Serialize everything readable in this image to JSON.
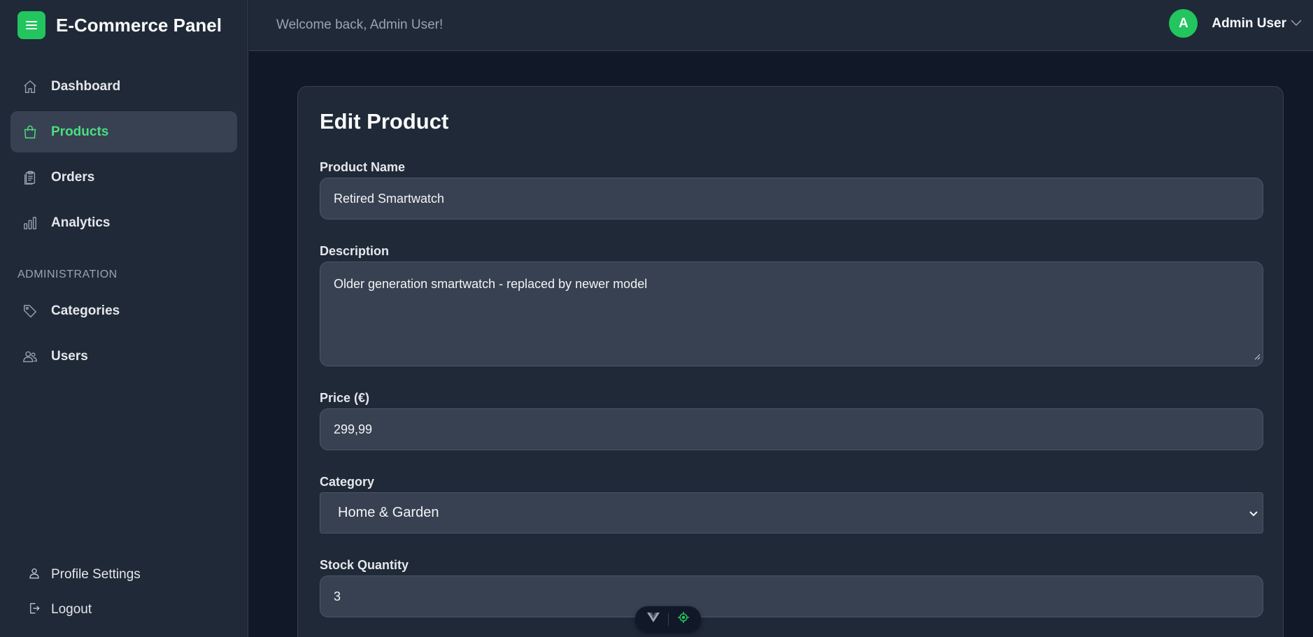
{
  "app": {
    "title": "E-Commerce Panel",
    "logo_icon": "hamburger-menu-icon",
    "accent_color": "#22c55e"
  },
  "sidebar": {
    "items": [
      {
        "label": "Dashboard",
        "icon": "home-icon",
        "active": false
      },
      {
        "label": "Products",
        "icon": "shopping-bag-icon",
        "active": true
      },
      {
        "label": "Orders",
        "icon": "clipboard-icon",
        "active": false
      },
      {
        "label": "Analytics",
        "icon": "bar-chart-icon",
        "active": false
      }
    ],
    "section_label": "ADMINISTRATION",
    "admin_items": [
      {
        "label": "Categories",
        "icon": "tag-icon"
      },
      {
        "label": "Users",
        "icon": "users-icon"
      }
    ],
    "bottom_items": [
      {
        "label": "Profile Settings",
        "icon": "user-icon"
      },
      {
        "label": "Logout",
        "icon": "logout-icon"
      }
    ]
  },
  "header": {
    "welcome": "Welcome back, Admin User!",
    "user": {
      "initial": "A",
      "name": "Admin User"
    }
  },
  "form": {
    "title": "Edit Product",
    "product_name": {
      "label": "Product Name",
      "value": "Retired Smartwatch"
    },
    "description": {
      "label": "Description",
      "value": "Older generation smartwatch - replaced by newer model"
    },
    "price": {
      "label": "Price (€)",
      "value": "299,99"
    },
    "category": {
      "label": "Category",
      "value": "Home & Garden"
    },
    "stock": {
      "label": "Stock Quantity",
      "value": "3"
    }
  },
  "floating_toolbar": {
    "icons": [
      "vue-logo-icon",
      "target-icon"
    ]
  }
}
